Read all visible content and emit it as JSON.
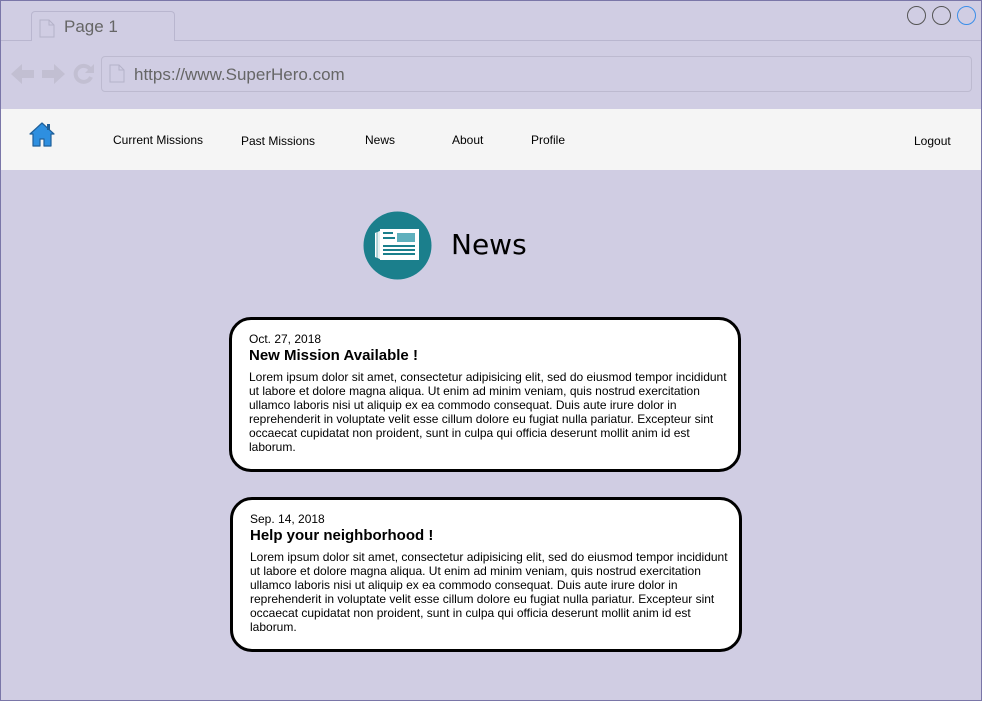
{
  "browser": {
    "tab_label": "Page 1",
    "url": "https://www.SuperHero.com"
  },
  "nav": {
    "items": [
      {
        "label": "Current Missions"
      },
      {
        "label": "Past Missions"
      },
      {
        "label": "News"
      },
      {
        "label": "About"
      },
      {
        "label": "Profile"
      }
    ],
    "logout": "Logout"
  },
  "main": {
    "title": "News",
    "articles": [
      {
        "date": "Oct. 27, 2018",
        "headline": "New Mission Available !",
        "body": "Lorem ipsum dolor sit amet, consectetur adipisicing elit, sed do eiusmod tempor incididunt ut labore et dolore magna aliqua. Ut enim ad minim veniam, quis nostrud exercitation ullamco laboris nisi ut aliquip ex ea commodo consequat. Duis aute irure dolor in reprehenderit in voluptate velit esse cillum dolore eu fugiat nulla pariatur. Excepteur sint occaecat cupidatat non proident, sunt in culpa qui officia deserunt mollit anim id est laborum."
      },
      {
        "date": "Sep. 14, 2018",
        "headline": "Help your neighborhood !",
        "body": "Lorem ipsum dolor sit amet, consectetur adipisicing elit, sed do eiusmod tempor incididunt ut labore et dolore magna aliqua. Ut enim ad minim veniam, quis nostrud exercitation ullamco laboris nisi ut aliquip ex ea commodo consequat. Duis aute irure dolor in reprehenderit in voluptate velit esse cillum dolore eu fugiat nulla pariatur. Excepteur sint occaecat cupidatat non proident, sunt in culpa qui officia deserunt mollit anim id est laborum."
      }
    ]
  },
  "icons": {
    "home": "home-icon",
    "news": "newspaper-icon",
    "back": "arrow-left-icon",
    "forward": "arrow-right-icon",
    "reload": "reload-icon",
    "document": "document-icon"
  },
  "colors": {
    "page_background": "#d0cde3",
    "nav_background": "#f5f5f5",
    "accent_teal": "#1b7f8c",
    "home_blue": "#2e8fe0"
  }
}
